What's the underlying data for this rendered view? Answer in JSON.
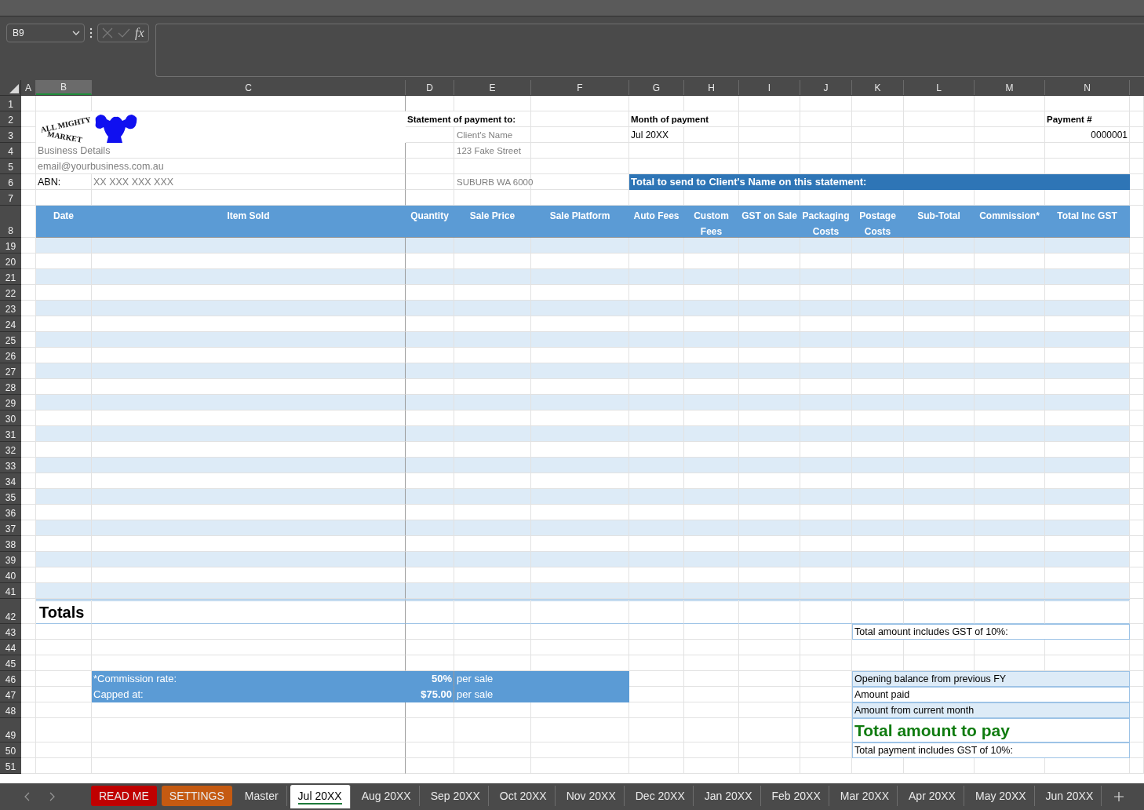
{
  "formula_bar": {
    "name_box": "B9",
    "function_label": "fx"
  },
  "logo": {
    "top_text": "ALL MIGHTY",
    "bottom_text": "MARKET"
  },
  "columns": [
    {
      "label": "A",
      "selected": false
    },
    {
      "label": "B",
      "selected": true
    },
    {
      "label": "C",
      "selected": false
    },
    {
      "label": "D",
      "selected": false
    },
    {
      "label": "E",
      "selected": false
    },
    {
      "label": "F",
      "selected": false
    },
    {
      "label": "G",
      "selected": false
    },
    {
      "label": "H",
      "selected": false
    },
    {
      "label": "I",
      "selected": false
    },
    {
      "label": "J",
      "selected": false
    },
    {
      "label": "K",
      "selected": false
    },
    {
      "label": "L",
      "selected": false
    },
    {
      "label": "M",
      "selected": false
    },
    {
      "label": "N",
      "selected": false
    }
  ],
  "rows": [
    {
      "number": "1",
      "kind": "plain"
    },
    {
      "number": "2",
      "kind": "plain",
      "cells": {
        "D": {
          "kind": "bold",
          "text": "Statement of payment to:"
        },
        "G": {
          "kind": "bold",
          "text": "Month of payment"
        },
        "N": {
          "kind": "bold",
          "text": "Payment #"
        }
      }
    },
    {
      "number": "3",
      "kind": "plain",
      "cells": {
        "E": {
          "kind": "muted",
          "text": "Client's Name"
        },
        "G": {
          "kind": "text",
          "text": "Jul 20XX"
        },
        "N": {
          "kind": "number",
          "text": "0000001"
        }
      }
    },
    {
      "number": "4",
      "kind": "plain",
      "cells": {
        "B": {
          "kind": "muted-large",
          "text": "Business Details"
        },
        "E": {
          "kind": "muted",
          "text": "123 Fake Street"
        }
      }
    },
    {
      "number": "5",
      "kind": "plain",
      "cells": {
        "B": {
          "kind": "muted-large",
          "text": "email@yourbusiness.com.au"
        }
      }
    },
    {
      "number": "6",
      "kind": "plain",
      "cells": {
        "B": {
          "kind": "text-large",
          "text": "ABN:"
        },
        "C": {
          "kind": "muted-value",
          "text": "XX XXX XXX XXX"
        },
        "E": {
          "kind": "muted",
          "text": "SUBURB  WA  6000"
        },
        "G": {
          "kind": "banner",
          "text": "Total to send to Client's Name on this statement:"
        }
      }
    },
    {
      "number": "7",
      "kind": "plain"
    },
    {
      "number": "8",
      "kind": "header",
      "cells": {
        "B": {
          "kind": "heading",
          "text": "Date"
        },
        "C": {
          "kind": "heading",
          "text": "Item Sold"
        },
        "D": {
          "kind": "heading",
          "text": "Quantity"
        },
        "E": {
          "kind": "heading",
          "text": "Sale Price"
        },
        "F": {
          "kind": "heading",
          "text": "Sale Platform"
        },
        "G": {
          "kind": "heading",
          "text": "Auto Fees"
        },
        "H": {
          "kind": "heading",
          "text": "Custom Fees"
        },
        "I": {
          "kind": "heading",
          "text": "GST on Sale"
        },
        "J": {
          "kind": "heading",
          "text": "Packaging Costs"
        },
        "K": {
          "kind": "heading",
          "text": "Postage Costs"
        },
        "L": {
          "kind": "heading",
          "text": "Sub-Total"
        },
        "M": {
          "kind": "heading",
          "text": "Commission*"
        },
        "N": {
          "kind": "heading",
          "text": "Total Inc GST"
        }
      }
    },
    {
      "number": "19",
      "kind": "band"
    },
    {
      "number": "20",
      "kind": "plain"
    },
    {
      "number": "21",
      "kind": "band"
    },
    {
      "number": "22",
      "kind": "plain"
    },
    {
      "number": "23",
      "kind": "band"
    },
    {
      "number": "24",
      "kind": "plain"
    },
    {
      "number": "25",
      "kind": "band"
    },
    {
      "number": "26",
      "kind": "plain"
    },
    {
      "number": "27",
      "kind": "band"
    },
    {
      "number": "28",
      "kind": "plain"
    },
    {
      "number": "29",
      "kind": "band"
    },
    {
      "number": "30",
      "kind": "plain"
    },
    {
      "number": "31",
      "kind": "band"
    },
    {
      "number": "32",
      "kind": "plain"
    },
    {
      "number": "33",
      "kind": "band"
    },
    {
      "number": "34",
      "kind": "plain"
    },
    {
      "number": "35",
      "kind": "band"
    },
    {
      "number": "36",
      "kind": "plain"
    },
    {
      "number": "37",
      "kind": "band"
    },
    {
      "number": "38",
      "kind": "plain"
    },
    {
      "number": "39",
      "kind": "band"
    },
    {
      "number": "40",
      "kind": "plain"
    },
    {
      "number": "41",
      "kind": "band"
    },
    {
      "number": "42",
      "kind": "title",
      "cells": {
        "B": {
          "kind": "totals-title",
          "text": "Totals"
        }
      }
    },
    {
      "number": "43",
      "kind": "plain",
      "cells": {
        "K": {
          "kind": "summary",
          "text": "Total amount includes GST of 10%:"
        }
      }
    },
    {
      "number": "44",
      "kind": "plain"
    },
    {
      "number": "45",
      "kind": "plain"
    },
    {
      "number": "46",
      "kind": "plain",
      "cells": {
        "C": {
          "kind": "rate-label",
          "text": "*Commission rate:"
        },
        "D": {
          "kind": "rate-value",
          "text": "50%"
        },
        "E": {
          "kind": "rate-unit",
          "text": "per sale"
        },
        "K": {
          "kind": "summary-band",
          "text": "Opening balance from previous FY"
        }
      }
    },
    {
      "number": "47",
      "kind": "plain",
      "cells": {
        "C": {
          "kind": "rate-label",
          "text": "Capped at:"
        },
        "D": {
          "kind": "rate-value",
          "text": "$75.00"
        },
        "E": {
          "kind": "rate-unit",
          "text": "per sale"
        },
        "K": {
          "kind": "summary",
          "text": "Amount paid"
        }
      }
    },
    {
      "number": "48",
      "kind": "plain",
      "cells": {
        "K": {
          "kind": "summary-band",
          "text": "Amount from current month"
        }
      }
    },
    {
      "number": "49",
      "kind": "tall",
      "cells": {
        "K": {
          "kind": "summary-title",
          "text": "Total amount to pay"
        }
      }
    },
    {
      "number": "50",
      "kind": "plain",
      "cells": {
        "K": {
          "kind": "summary",
          "text": "Total payment includes GST of 10%:"
        }
      }
    },
    {
      "number": "51",
      "kind": "plain"
    }
  ],
  "sheet_tabs": [
    {
      "label": "READ ME",
      "selected": false,
      "color": "#c00000"
    },
    {
      "label": "SETTINGS",
      "selected": false,
      "color": "#c55a11"
    },
    {
      "label": "Master",
      "selected": false
    },
    {
      "label": "Jul 20XX",
      "selected": true
    },
    {
      "label": "Aug 20XX",
      "selected": false
    },
    {
      "label": "Sep 20XX",
      "selected": false
    },
    {
      "label": "Oct 20XX",
      "selected": false
    },
    {
      "label": "Nov 20XX",
      "selected": false
    },
    {
      "label": "Dec 20XX",
      "selected": false
    },
    {
      "label": "Jan 20XX",
      "selected": false
    },
    {
      "label": "Feb 20XX",
      "selected": false
    },
    {
      "label": "Mar 20XX",
      "selected": false
    },
    {
      "label": "Apr 20XX",
      "selected": false
    },
    {
      "label": "May 20XX",
      "selected": false
    },
    {
      "label": "Jun 20XX",
      "selected": false
    }
  ]
}
